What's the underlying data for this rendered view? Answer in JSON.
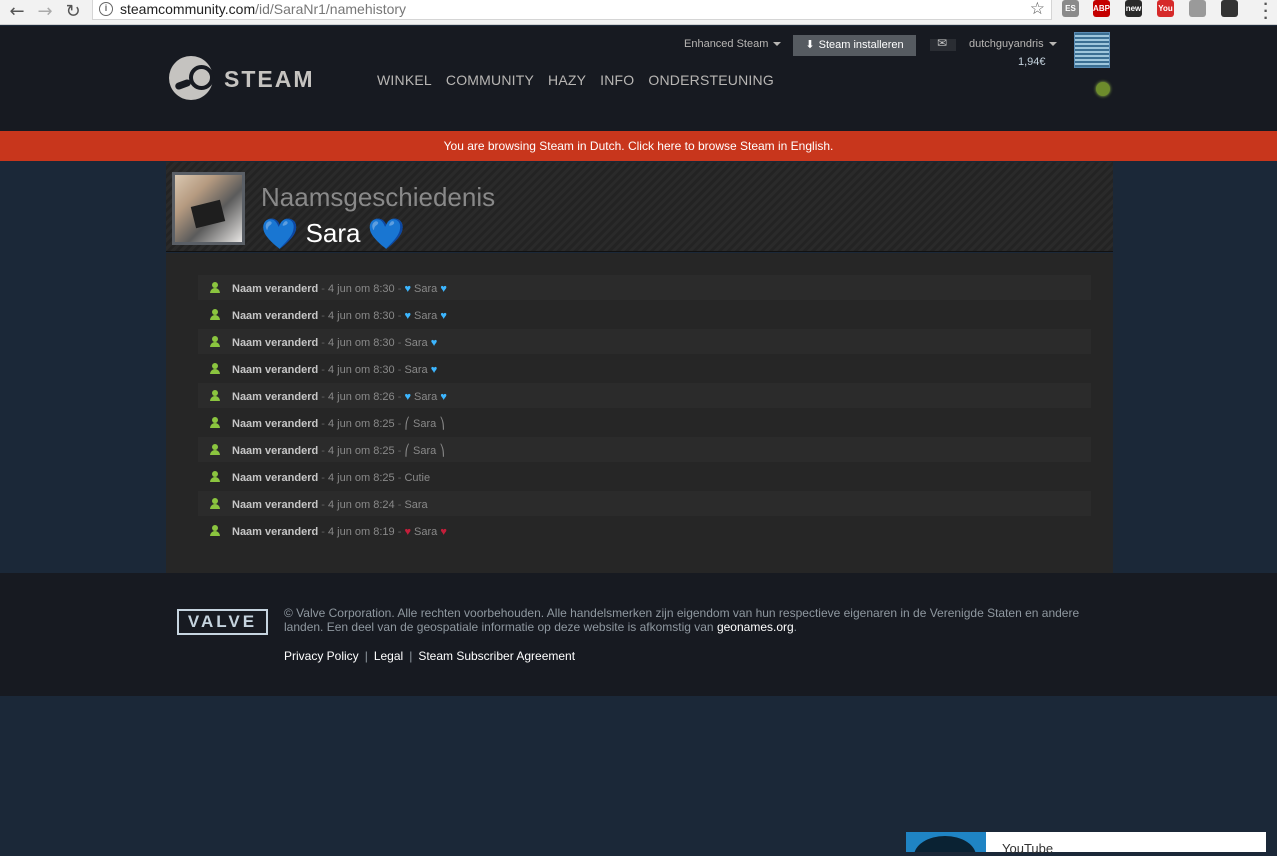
{
  "browser": {
    "back": "←",
    "forward": "→",
    "reload": "↻",
    "url_host": "steamcommunity.com",
    "url_path": "/id/SaraNr1/namehistory",
    "star": "☆",
    "extensions": [
      {
        "name": "es-extension-icon",
        "label": "ES",
        "color": "#8a8a8a"
      },
      {
        "name": "adblock-icon",
        "label": "ABP",
        "color": "#c40000"
      },
      {
        "name": "new-badge-extension-icon",
        "label": "new",
        "color": "#2a2a2a"
      },
      {
        "name": "youtube-extension-icon",
        "label": "You",
        "color": "#d62a2a"
      },
      {
        "name": "tag-extension-icon",
        "label": "",
        "color": "#9a9a9a"
      },
      {
        "name": "flag-extension-icon",
        "label": "",
        "color": "#333333"
      }
    ]
  },
  "header": {
    "logo_text": "STEAM",
    "nav": [
      "WINKEL",
      "COMMUNITY",
      "HAZY",
      "INFO",
      "ONDERSTEUNING"
    ],
    "enhanced_steam": "Enhanced Steam",
    "install_label": "Steam installeren",
    "account_name": "dutchguyandris",
    "wallet": "1,94€"
  },
  "banner": {
    "text": "You are browsing Steam in Dutch. Click here to browse Steam in English."
  },
  "profile": {
    "subtitle": "Naamsgeschiedenis",
    "name": "Sara",
    "heart": "💙"
  },
  "history": {
    "rows": [
      {
        "label": "Naam veranderd",
        "date": "4 jun om 8:30",
        "pre": "♥",
        "name": "Sara",
        "post": "♥",
        "color": "blue"
      },
      {
        "label": "Naam veranderd",
        "date": "4 jun om 8:30",
        "pre": "♥",
        "name": "Sara",
        "post": "♥",
        "color": "blue"
      },
      {
        "label": "Naam veranderd",
        "date": "4 jun om 8:30",
        "pre": "",
        "name": "Sara",
        "post": "♥",
        "color": "blue"
      },
      {
        "label": "Naam veranderd",
        "date": "4 jun om 8:30",
        "pre": "",
        "name": "Sara",
        "post": "♥",
        "color": "blue"
      },
      {
        "label": "Naam veranderd",
        "date": "4 jun om 8:26",
        "pre": "♥",
        "name": "Sara",
        "post": "♥",
        "color": "blue"
      },
      {
        "label": "Naam veranderd",
        "date": "4 jun om 8:25",
        "pre": "⎛ ",
        "name": "Sara",
        "post": " ⎞",
        "color": "grey"
      },
      {
        "label": "Naam veranderd",
        "date": "4 jun om 8:25",
        "pre": "⎛ ",
        "name": "Sara",
        "post": " ⎞",
        "color": "grey"
      },
      {
        "label": "Naam veranderd",
        "date": "4 jun om 8:25",
        "pre": "",
        "name": "Cutie",
        "post": "",
        "color": "grey"
      },
      {
        "label": "Naam veranderd",
        "date": "4 jun om 8:24",
        "pre": "",
        "name": "Sara",
        "post": "",
        "color": "grey"
      },
      {
        "label": "Naam veranderd",
        "date": "4 jun om 8:19",
        "pre": "♥",
        "name": "Sara",
        "post": "♥",
        "color": "red"
      }
    ]
  },
  "footer": {
    "valve_logo": "VALVE",
    "copyright": "© Valve Corporation. Alle rechten voorbehouden. Alle handelsmerken zijn eigendom van hun respectieve eigenaren in de Verenigde Staten en andere landen. Een deel van de geospatiale informatie op deze website is afkomstig van",
    "geonames": "geonames.org",
    "period": ".",
    "links": [
      "Privacy Policy",
      "Legal",
      "Steam Subscriber Agreement"
    ]
  },
  "popup": {
    "label": "YouTube"
  }
}
